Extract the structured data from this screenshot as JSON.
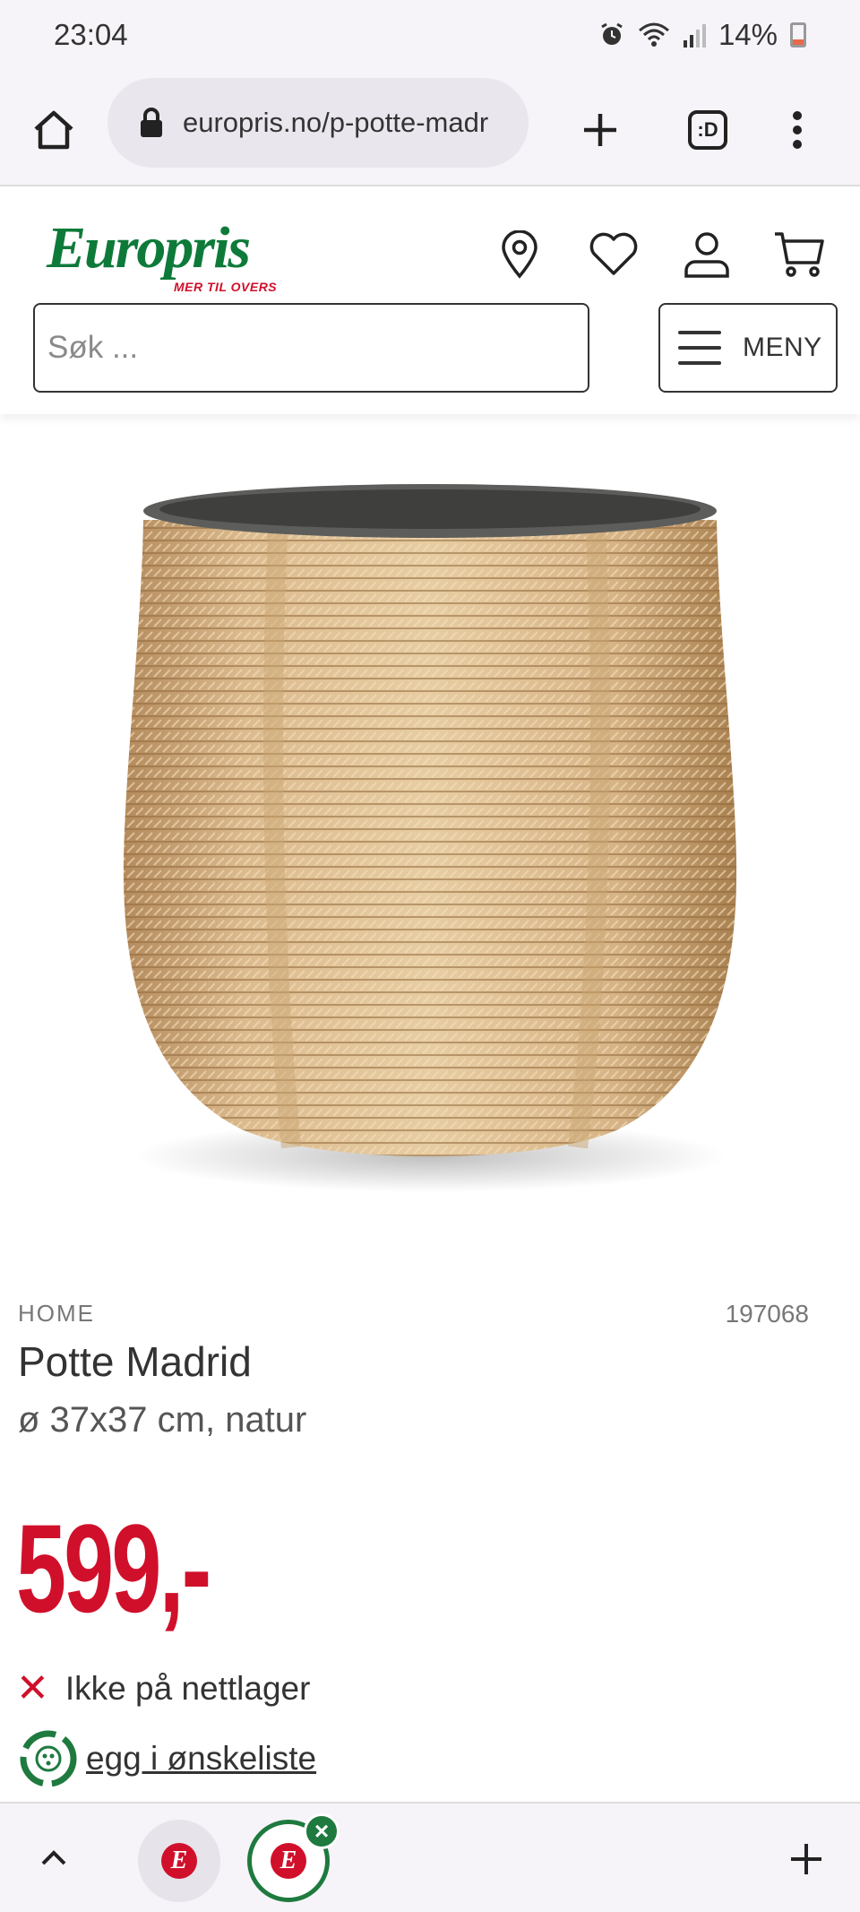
{
  "status_bar": {
    "time": "23:04",
    "battery": "14%",
    "icons": [
      "alarm-icon",
      "wifi-icon",
      "signal-icon",
      "battery-icon"
    ]
  },
  "browser": {
    "url": "europris.no/p-potte-madr",
    "tab_count": ":D",
    "icons": [
      "home-icon",
      "lock-icon",
      "new-tab-icon",
      "tab-switcher-icon",
      "overflow-menu-icon"
    ]
  },
  "site_header": {
    "logo_text": "Europris",
    "logo_tagline": "MER TIL OVERS",
    "search_placeholder": "Søk ...",
    "menu_label": "MENY",
    "icons": [
      "location-pin-icon",
      "heart-icon",
      "user-icon",
      "cart-icon"
    ]
  },
  "product": {
    "category": "HOME",
    "sku": "197068",
    "title": "Potte Madrid",
    "subtitle": "ø 37x37 cm, natur",
    "price": "599,-",
    "stock_status": "Ikke på nettlager",
    "wishlist_label": "egg i ønskeliste"
  },
  "bottom_bar": {
    "tab_logo_letter": "E",
    "icons": [
      "chevron-up-icon",
      "close-icon",
      "plus-icon"
    ]
  },
  "colors": {
    "brand_green": "#0e7a3a",
    "brand_red": "#d0102b",
    "chrome_bg": "#f6f4f8"
  }
}
